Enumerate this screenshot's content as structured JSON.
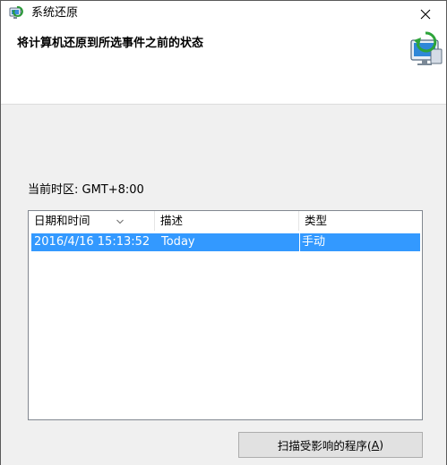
{
  "window": {
    "title": "系统还原",
    "close_icon": "close-icon",
    "app_icon": "system-restore-icon"
  },
  "header": {
    "title": "将计算机还原到所选事件之前的状态",
    "icon": "system-restore-computer-icon"
  },
  "timezone": {
    "text": "当前时区: GMT+8:00"
  },
  "restore_points": {
    "columns": [
      "日期和时间",
      "描述",
      "类型"
    ],
    "sort_icon": "sort-chevron-down-icon",
    "rows": [
      {
        "date": "2016/4/16 15:13:52",
        "description": "Today",
        "type": "手动",
        "selected": true
      }
    ]
  },
  "buttons": {
    "scan_label_prefix": "扫描受影响的程序(",
    "scan_label_access": "A",
    "scan_label_suffix": ")"
  },
  "colors": {
    "selection": "#3399ff",
    "window_bg": "#f0f0f0",
    "header_bg": "#ffffff"
  }
}
